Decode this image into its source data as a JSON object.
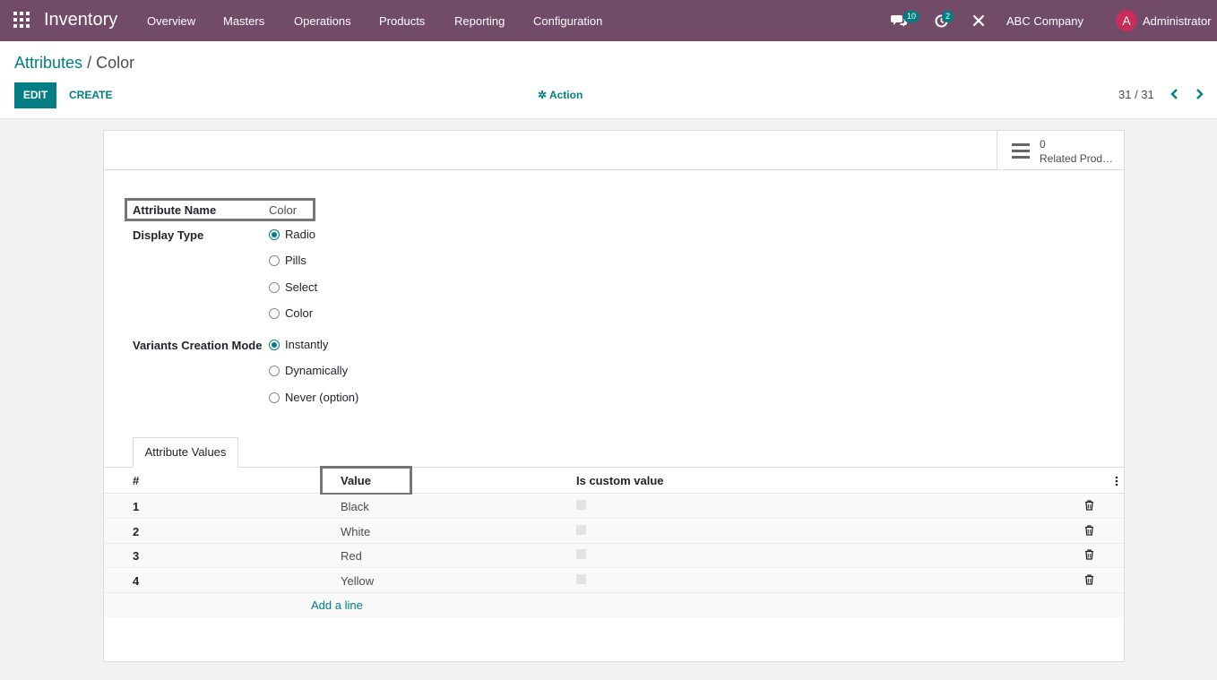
{
  "navbar": {
    "app_name": "Inventory",
    "menu": [
      "Overview",
      "Masters",
      "Operations",
      "Products",
      "Reporting",
      "Configuration"
    ],
    "messages_count": "10",
    "activities_count": "2",
    "company": "ABC Company",
    "avatar_letter": "A",
    "user": "Administrator",
    "colors": {
      "bar": "#714b67",
      "badge": "#017e84",
      "avatar": "#c92e5a"
    }
  },
  "breadcrumb": {
    "parent": "Attributes",
    "separator": "/",
    "current": "Color"
  },
  "toolbar": {
    "edit_label": "EDIT",
    "create_label": "CREATE",
    "action_label": "Action"
  },
  "pager": {
    "value": "31 / 31"
  },
  "smart_button": {
    "count": "0",
    "label": "Related Products"
  },
  "form": {
    "attribute_name_label": "Attribute Name",
    "attribute_name_value": "Color",
    "display_type_label": "Display Type",
    "display_type_options": [
      "Radio",
      "Pills",
      "Select",
      "Color"
    ],
    "display_type_selected": "Radio",
    "variants_mode_label": "Variants Creation Mode",
    "variants_mode_options": [
      "Instantly",
      "Dynamically",
      "Never (option)"
    ],
    "variants_mode_selected": "Instantly"
  },
  "tabs": {
    "attribute_values": "Attribute Values"
  },
  "table": {
    "headers": {
      "index": "#",
      "value": "Value",
      "custom": "Is custom value"
    },
    "rows": [
      {
        "index": "1",
        "value": "Black",
        "custom": false
      },
      {
        "index": "2",
        "value": "White",
        "custom": false
      },
      {
        "index": "3",
        "value": "Red",
        "custom": false
      },
      {
        "index": "4",
        "value": "Yellow",
        "custom": false
      }
    ],
    "add_line": "Add a line"
  },
  "accent_color": "#017e84"
}
